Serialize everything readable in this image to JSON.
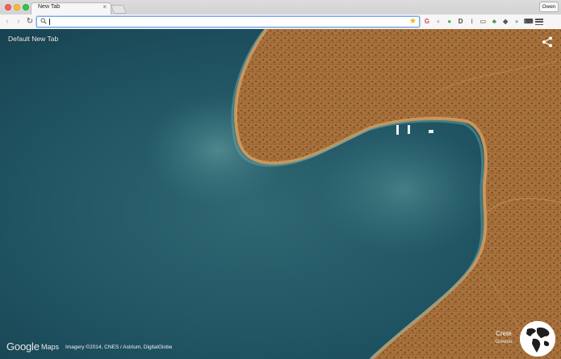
{
  "window": {
    "tab_title": "New Tab",
    "tab_close": "×",
    "profile_name": "Owen"
  },
  "toolbar": {
    "back_icon": "‹",
    "forward_icon": "›",
    "reload_icon": "↻",
    "omnibox_value": "",
    "bookmark_icon": "★",
    "extensions": [
      {
        "name": "g-extension-icon",
        "glyph": "G",
        "color": "#e2425b"
      },
      {
        "name": "grey-circle-extension-icon",
        "glyph": "●",
        "color": "#c6c6c6"
      },
      {
        "name": "green-extension-icon",
        "glyph": "●",
        "color": "#3ab54a"
      },
      {
        "name": "d-extension-icon",
        "glyph": "D",
        "color": "#444444"
      },
      {
        "name": "info-extension-icon",
        "glyph": "i",
        "color": "#7a7a7a"
      },
      {
        "name": "screen-extension-icon",
        "glyph": "▭",
        "color": "#8a8a8a"
      },
      {
        "name": "plant-extension-icon",
        "glyph": "♣",
        "color": "#3b8c3b"
      },
      {
        "name": "pocket-extension-icon",
        "glyph": "◆",
        "color": "#555555"
      },
      {
        "name": "blue-extension-icon",
        "glyph": "●",
        "color": "#7fb6e8"
      },
      {
        "name": "keyboard-extension-icon",
        "glyph": "⌨",
        "color": "#444444"
      }
    ]
  },
  "page": {
    "title": "Default New Tab",
    "share_icon": "share-icon",
    "google_logo": "Google",
    "maps_word": "Maps",
    "attribution": "Imagery ©2014, CNES / Astrium, DigitalGlobe",
    "location_name": "Crete",
    "location_country": "Greece",
    "globe_icon": "globe-icon"
  },
  "colors": {
    "sea_deep": "#1b4756",
    "sea_shallow": "#3f7c84",
    "land": "#b97f44",
    "land_dark": "#8f5e2e"
  }
}
